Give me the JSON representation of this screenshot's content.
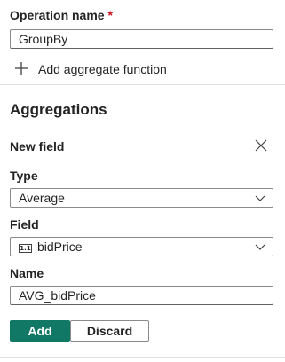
{
  "operation": {
    "label": "Operation name",
    "required_mark": "*",
    "value": "GroupBy"
  },
  "add_aggregate": {
    "label": "Add aggregate function",
    "icon": "plus-icon"
  },
  "aggregations": {
    "title": "Aggregations",
    "new_field": {
      "title": "New field",
      "close_icon": "close-icon",
      "type_label": "Type",
      "type_value": "Average",
      "field_label": "Field",
      "field_value": "bidPrice",
      "field_type_icon": "1.1",
      "name_label": "Name",
      "name_value": "AVG_bidPrice"
    },
    "buttons": {
      "add": "Add",
      "discard": "Discard"
    }
  },
  "colors": {
    "accent": "#117865",
    "required": "#c50f1f",
    "border": "#8a8a8a",
    "divider": "#e0e0e0"
  }
}
